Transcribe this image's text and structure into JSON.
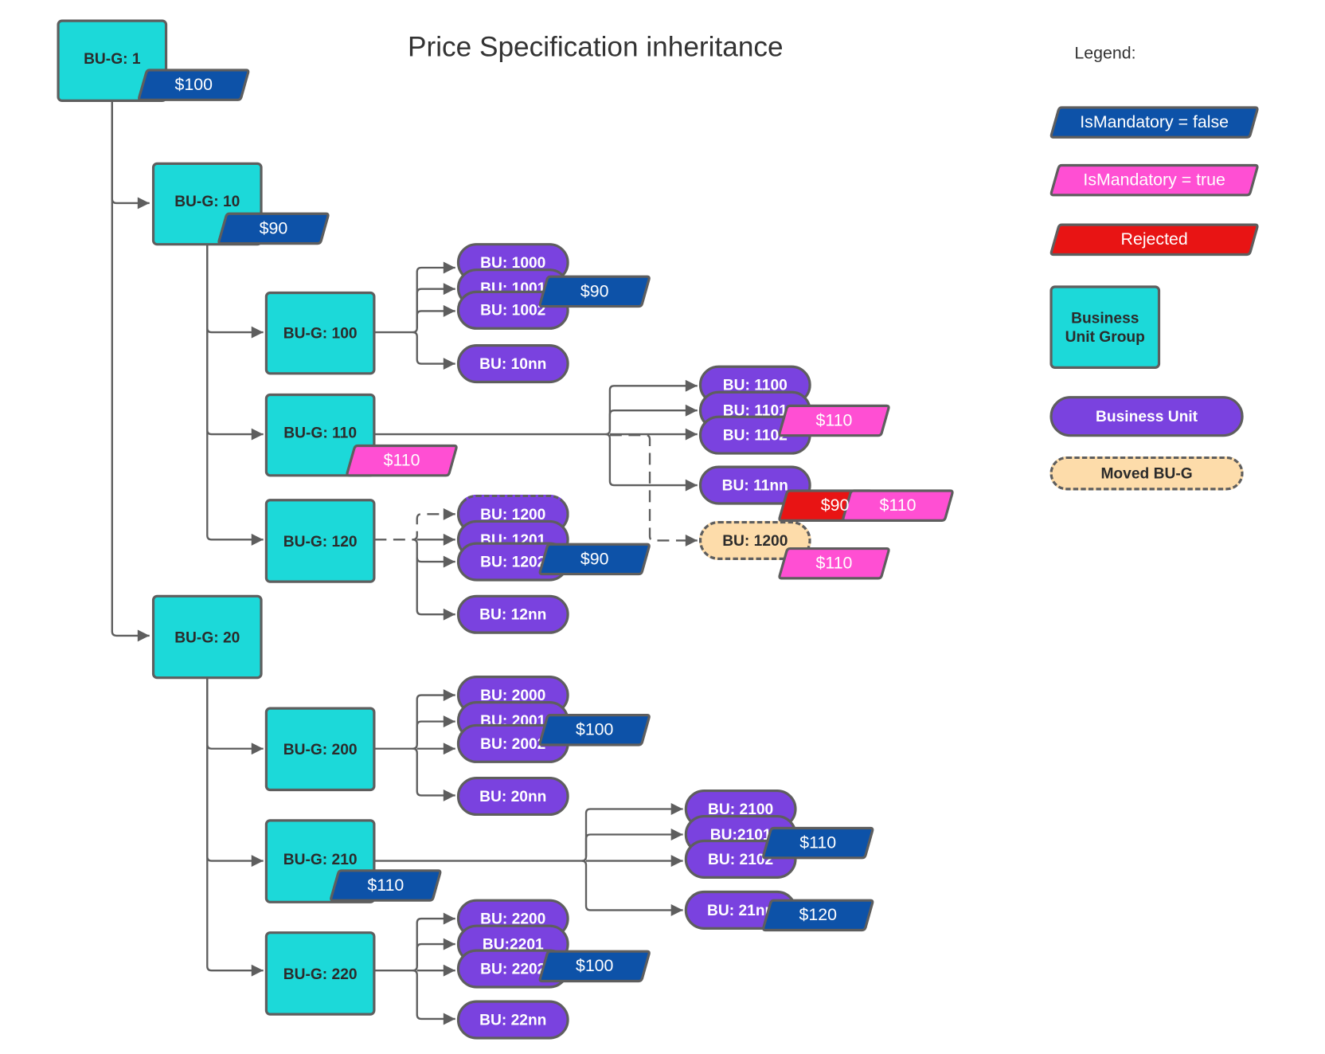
{
  "title": "Price Specification inheritance",
  "colors": {
    "bug_fill": "#1cd9d9",
    "bu_fill": "#7a42df",
    "moved_fill": "#fddcaa",
    "mandatory_false": "#0d52a8",
    "mandatory_true": "#ff4fd3",
    "rejected": "#e81414",
    "stroke": "#5e5e5e",
    "text_dark": "#2b2b2b"
  },
  "legend": {
    "title": "Legend:",
    "items": [
      {
        "kind": "price",
        "variant": "false",
        "label": "IsMandatory = false"
      },
      {
        "kind": "price",
        "variant": "true",
        "label": "IsMandatory = true"
      },
      {
        "kind": "price",
        "variant": "rejected",
        "label": "Rejected"
      },
      {
        "kind": "bug",
        "label": "Business Unit Group"
      },
      {
        "kind": "bu",
        "label": "Business Unit"
      },
      {
        "kind": "moved",
        "label": "Moved BU-G"
      }
    ]
  },
  "groups": {
    "g1": {
      "label": "BU-G: 1",
      "price": "$100",
      "mandatory": false
    },
    "g10": {
      "label": "BU-G: 10",
      "price": "$90",
      "mandatory": false
    },
    "g100": {
      "label": "BU-G: 100"
    },
    "g110": {
      "label": "BU-G: 110",
      "price": "$110",
      "mandatory": true
    },
    "g120": {
      "label": "BU-G: 120"
    },
    "g20": {
      "label": "BU-G: 20"
    },
    "g200": {
      "label": "BU-G: 200"
    },
    "g210": {
      "label": "BU-G: 210",
      "price": "$110",
      "mandatory": false
    },
    "g220": {
      "label": "BU-G: 220"
    }
  },
  "units": {
    "g100": {
      "items": [
        "BU: 1000",
        "BU: 1001",
        "BU: 1002",
        "BU: 10nn"
      ],
      "price": "$90",
      "mandatory": false
    },
    "g110": {
      "items": [
        "BU: 1100",
        "BU: 1101",
        "BU: 1102",
        "BU: 11nn"
      ],
      "price": "$110",
      "mandatory": true,
      "nn_prices": [
        {
          "value": "$90",
          "status": "rejected"
        },
        {
          "value": "$110",
          "status": "mandatory"
        }
      ]
    },
    "g110_moved": {
      "label": "BU: 1200",
      "price": "$110",
      "mandatory": true
    },
    "g120": {
      "items": [
        "BU: 1200",
        "BU: 1201",
        "BU: 1202",
        "BU: 12nn"
      ],
      "price": "$90",
      "mandatory": false
    },
    "g200": {
      "items": [
        "BU: 2000",
        "BU: 2001",
        "BU: 2002",
        "BU: 20nn"
      ],
      "price": "$100",
      "mandatory": false
    },
    "g210": {
      "items": [
        "BU: 2100",
        "BU:2101",
        "BU: 2102",
        "BU: 21nn"
      ],
      "price": "$110",
      "mandatory": false,
      "nn_price": "$120"
    },
    "g220": {
      "items": [
        "BU: 2200",
        "BU:2201",
        "BU: 2202",
        "BU: 22nn"
      ],
      "price": "$100",
      "mandatory": false
    }
  }
}
